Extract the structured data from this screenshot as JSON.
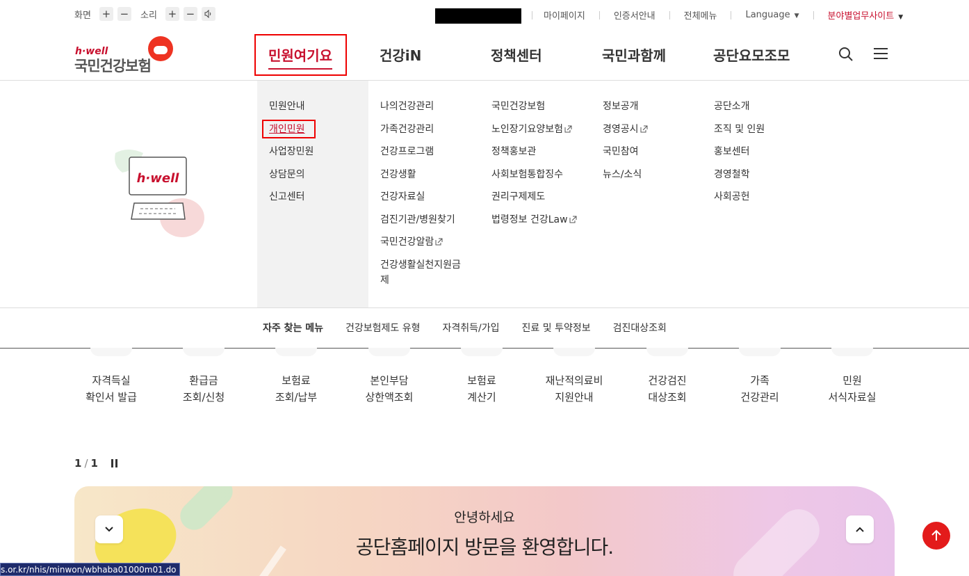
{
  "utilbar": {
    "screen_label": "화면",
    "sound_label": "소리",
    "plus": "+",
    "minus": "−",
    "links": [
      "마이페이지",
      "인증서안내",
      "전체메뉴"
    ],
    "language_label": "Language",
    "branch_label": "분야별업무사이트"
  },
  "logo": {
    "hwell": "h·well",
    "name": "국민건강보험"
  },
  "gnb": {
    "items": [
      "민원여기요",
      "건강iN",
      "정책센터",
      "국민과함께",
      "공단요모조모"
    ],
    "active_index": 0
  },
  "mega": {
    "illustration_text": "h·well",
    "columns": [
      [
        "민원안내",
        "개인민원",
        "사업장민원",
        "상담문의",
        "신고센터"
      ],
      [
        "나의건강관리",
        "가족건강관리",
        "건강프로그램",
        "건강생활",
        "건강자료실",
        "검진기관/병원찾기",
        "국민건강알람",
        "건강생활실천지원금",
        "제"
      ],
      [
        "국민건강보험",
        "노인장기요양보험",
        "정책홍보관",
        "사회보험통합징수",
        "권리구제제도",
        "법령정보 건강Law"
      ],
      [
        "정보공개",
        "경영공시",
        "국민참여",
        "뉴스/소식"
      ],
      [
        "공단소개",
        "조직 및 인원",
        "홍보센터",
        "경영철학",
        "사회공헌"
      ]
    ],
    "selected": "개인민원"
  },
  "freq": {
    "title": "자주 찾는 메뉴",
    "links": [
      "건강보험제도 유형",
      "자격취득/가입",
      "진료 및 투약정보",
      "검진대상조회"
    ]
  },
  "quick": [
    [
      "자격득실",
      "확인서 발급"
    ],
    [
      "환급금",
      "조회/신청"
    ],
    [
      "보험료",
      "조회/납부"
    ],
    [
      "본인부담",
      "상한액조회"
    ],
    [
      "보험료",
      "계산기"
    ],
    [
      "재난적의료비",
      "지원안내"
    ],
    [
      "건강검진",
      "대상조회"
    ],
    [
      "가족",
      "건강관리"
    ],
    [
      "민원",
      "서식자료실"
    ]
  ],
  "pager": {
    "current": "1",
    "sep": "/",
    "total": "1"
  },
  "banner": {
    "hello": "안녕하세요",
    "welcome": "공단홈페이지 방문을 환영합니다."
  },
  "statusbar": {
    "url": "s.or.kr/nhis/minwon/wbhaba01000m01.do"
  },
  "colors": {
    "brand_red": "#c8102e",
    "highlight_red": "#e00000",
    "top_button": "#e31b1b"
  }
}
